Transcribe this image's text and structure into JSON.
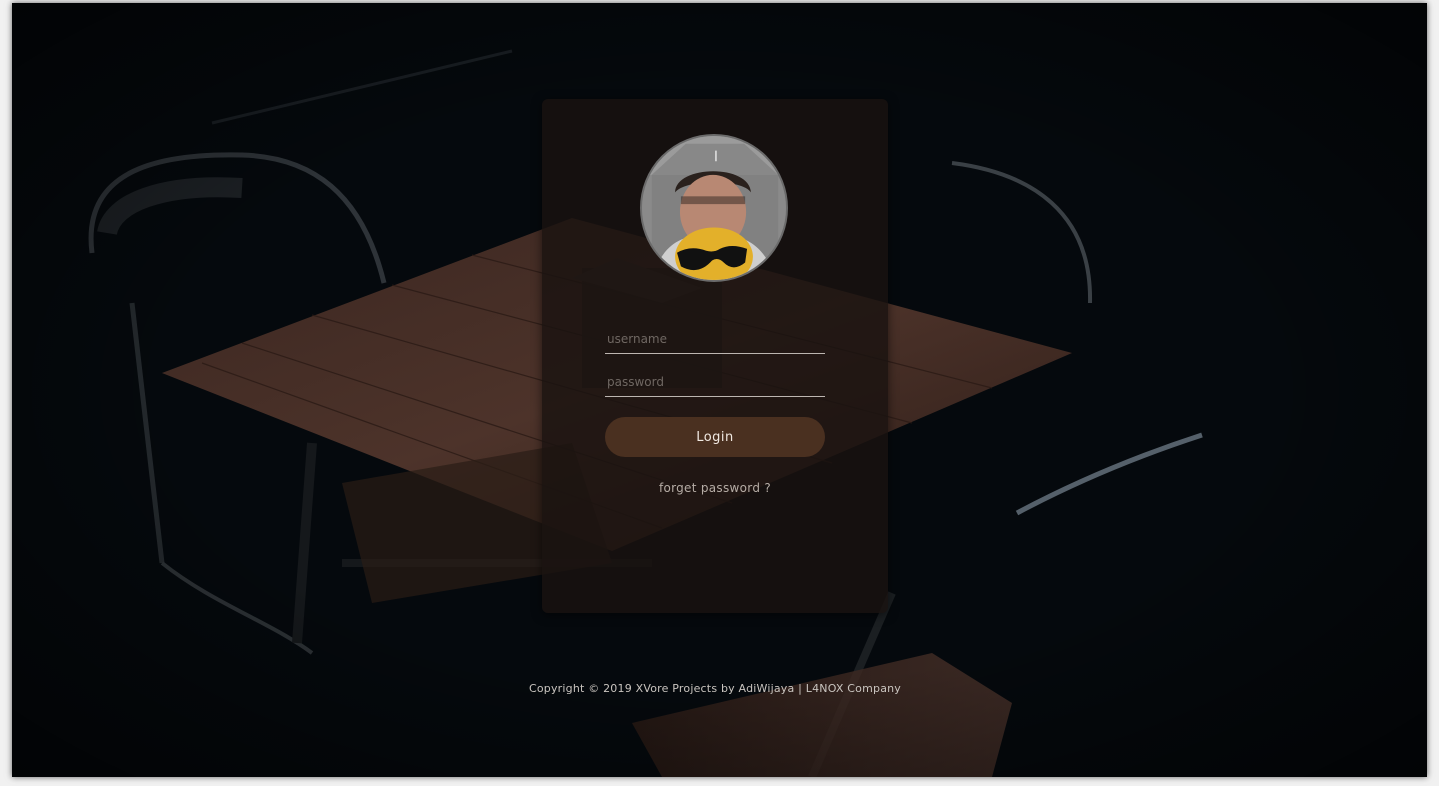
{
  "login": {
    "username_placeholder": "username",
    "password_placeholder": "password",
    "login_label": "Login",
    "forget_label": "forget password ?"
  },
  "footer": {
    "copyright": "Copyright © 2019 XVore Projects by AdiWijaya | L4NOX Company"
  },
  "avatar": {
    "icon": "sunglasses-emoji-icon"
  },
  "colors": {
    "background": "#05090d",
    "card": "#1a1210",
    "button": "#4a3020",
    "emoji": "#e3b02a"
  }
}
